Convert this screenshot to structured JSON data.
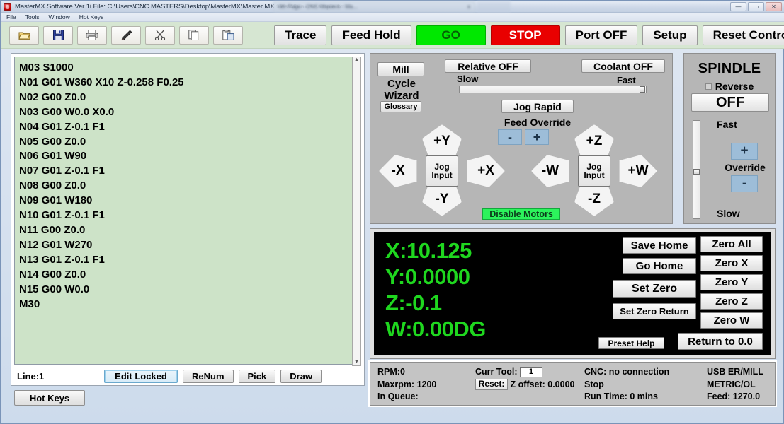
{
  "window": {
    "title": "MasterMX Software Ver 1i File: C:\\Users\\CNC MASTERS\\Desktop\\MasterMX\\Master MX files\\4th axis sample.txt",
    "ghost_title": "4th Page - CNC Masters - Ma...",
    "ghost_close": "x",
    "minimize": "—",
    "maximize": "▭",
    "close": "✕"
  },
  "menu": {
    "items": [
      "File",
      "Tools",
      "Window",
      "Hot Keys"
    ]
  },
  "toolbar": {
    "icons": [
      {
        "name": "open-file-icon",
        "glyph": "open"
      },
      {
        "name": "save-file-icon",
        "glyph": "save"
      },
      {
        "name": "print-icon",
        "glyph": "print"
      },
      {
        "name": "edit-pencil-icon",
        "glyph": "pencil"
      },
      {
        "name": "cut-icon",
        "glyph": "scissors"
      },
      {
        "name": "copy-icon",
        "glyph": "copy"
      },
      {
        "name": "paste-icon",
        "glyph": "paste"
      }
    ],
    "trace": "Trace",
    "feed_hold": "Feed Hold",
    "go": "GO",
    "stop": "STOP",
    "port": "Port OFF",
    "setup": "Setup",
    "reset_control": "Reset Control",
    "go_color": "#00e800",
    "stop_color": "#e90000"
  },
  "editor": {
    "code_lines": [
      "M03 S1000",
      "N01 G01 W360 X10 Z-0.258 F0.25",
      "N02 G00 Z0.0",
      "N03 G00 W0.0 X0.0",
      "N04 G01 Z-0.1 F1",
      "N05 G00 Z0.0",
      "N06 G01 W90",
      "N07 G01 Z-0.1 F1",
      "N08 G00 Z0.0",
      "N09 G01 W180",
      "N10 G01 Z-0.1 F1",
      "N11 G00 Z0.0",
      "N12 G01 W270",
      "N13 G01 Z-0.1 F1",
      "N14 G00 Z0.0",
      "N15 G00 W0.0",
      "M30"
    ],
    "line_status": "Line:1",
    "edit_locked": "Edit Locked",
    "renum": "ReNum",
    "pick": "Pick",
    "draw": "Draw",
    "scroll_up": "▲",
    "scroll_down": "▼",
    "background_color": "#cde3c8"
  },
  "hot_keys_button": "Hot Keys",
  "jog_panel": {
    "mill": "Mill",
    "cycle_wizard": "Cycle\nWizard",
    "cycle_wizard_line1": "Cycle",
    "cycle_wizard_line2": "Wizard",
    "glossary": "Glossary",
    "relative": "Relative OFF",
    "coolant": "Coolant OFF",
    "slow": "Slow",
    "fast": "Fast",
    "jog_rapid": "Jog Rapid",
    "feed_override": "Feed Override",
    "feed_minus": "-",
    "feed_plus": "+",
    "axis_left": {
      "up": "+Y",
      "down": "-Y",
      "left": "-X",
      "right": "+X",
      "center_line1": "Jog",
      "center_line2": "Input"
    },
    "axis_right": {
      "up": "+Z",
      "down": "-Z",
      "left": "-W",
      "right": "+W",
      "center_line1": "Jog",
      "center_line2": "Input"
    },
    "disable_motors": "Disable Motors",
    "disable_motors_color": "#2cf35c"
  },
  "spindle": {
    "title": "SPINDLE",
    "reverse": "Reverse",
    "state": "OFF",
    "fast": "Fast",
    "slow": "Slow",
    "override": "Override",
    "plus": "+",
    "minus": "-"
  },
  "dro": {
    "x": "X:10.125",
    "y": "Y:0.0000",
    "z": "Z:-0.1",
    "w": "W:0.00DG",
    "text_color": "#1fd71f",
    "buttons": {
      "save_home": "Save Home",
      "go_home": "Go Home",
      "set_zero": "Set Zero",
      "set_zero_return": "Set Zero Return",
      "zero_all": "Zero All",
      "zero_x": "Zero X",
      "zero_y": "Zero Y",
      "zero_z": "Zero Z",
      "zero_w": "Zero W",
      "return_to_zero": "Return to 0.0",
      "preset_help": "Preset Help"
    }
  },
  "status": {
    "rpm": "RPM:0",
    "maxrpm": "Maxrpm: 1200",
    "in_queue": "In Queue:",
    "curr_tool_label": "Curr Tool:",
    "curr_tool_value": "1",
    "reset": "Reset:",
    "z_offset": "Z offset: 0.0000",
    "cnc": "CNC: no connection",
    "stop": "Stop",
    "run_time": "Run Time: 0 mins",
    "usb": "USB ER/MILL",
    "units": "METRIC/OL",
    "feed": "Feed: 1270.0"
  }
}
